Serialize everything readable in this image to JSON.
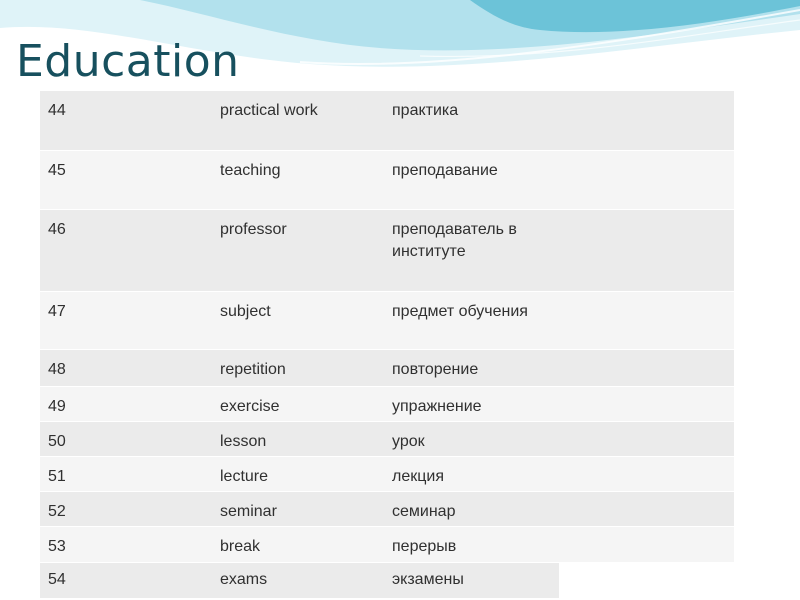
{
  "slide": {
    "title": "Education"
  },
  "colors": {
    "title": "#17505e",
    "wave_light": "#d6f0f6",
    "wave_mid": "#a7dcea",
    "wave_dark": "#5cbcd3",
    "row_odd": "#ebebeb",
    "row_even": "#f5f5f5"
  },
  "table": {
    "rows": [
      {
        "num": "44",
        "en": "practical work",
        "ru": "практика"
      },
      {
        "num": "45",
        "en": "teaching",
        "ru": "преподавание"
      },
      {
        "num": "46",
        "en": "professor",
        "ru": "преподаватель в институте"
      },
      {
        "num": "47",
        "en": "subject",
        "ru": "предмет обучения"
      },
      {
        "num": "48",
        "en": "repetition",
        "ru": "повторение"
      },
      {
        "num": "49",
        "en": "exercise",
        "ru": "упражнение"
      },
      {
        "num": "50",
        "en": "lesson",
        "ru": "урок"
      },
      {
        "num": "51",
        "en": "lecture",
        "ru": "лекция"
      },
      {
        "num": "52",
        "en": "seminar",
        "ru": "семинар"
      },
      {
        "num": "53",
        "en": "break",
        "ru": "перерыв"
      },
      {
        "num": "54",
        "en": "exams",
        "ru": "экзамены"
      }
    ]
  }
}
